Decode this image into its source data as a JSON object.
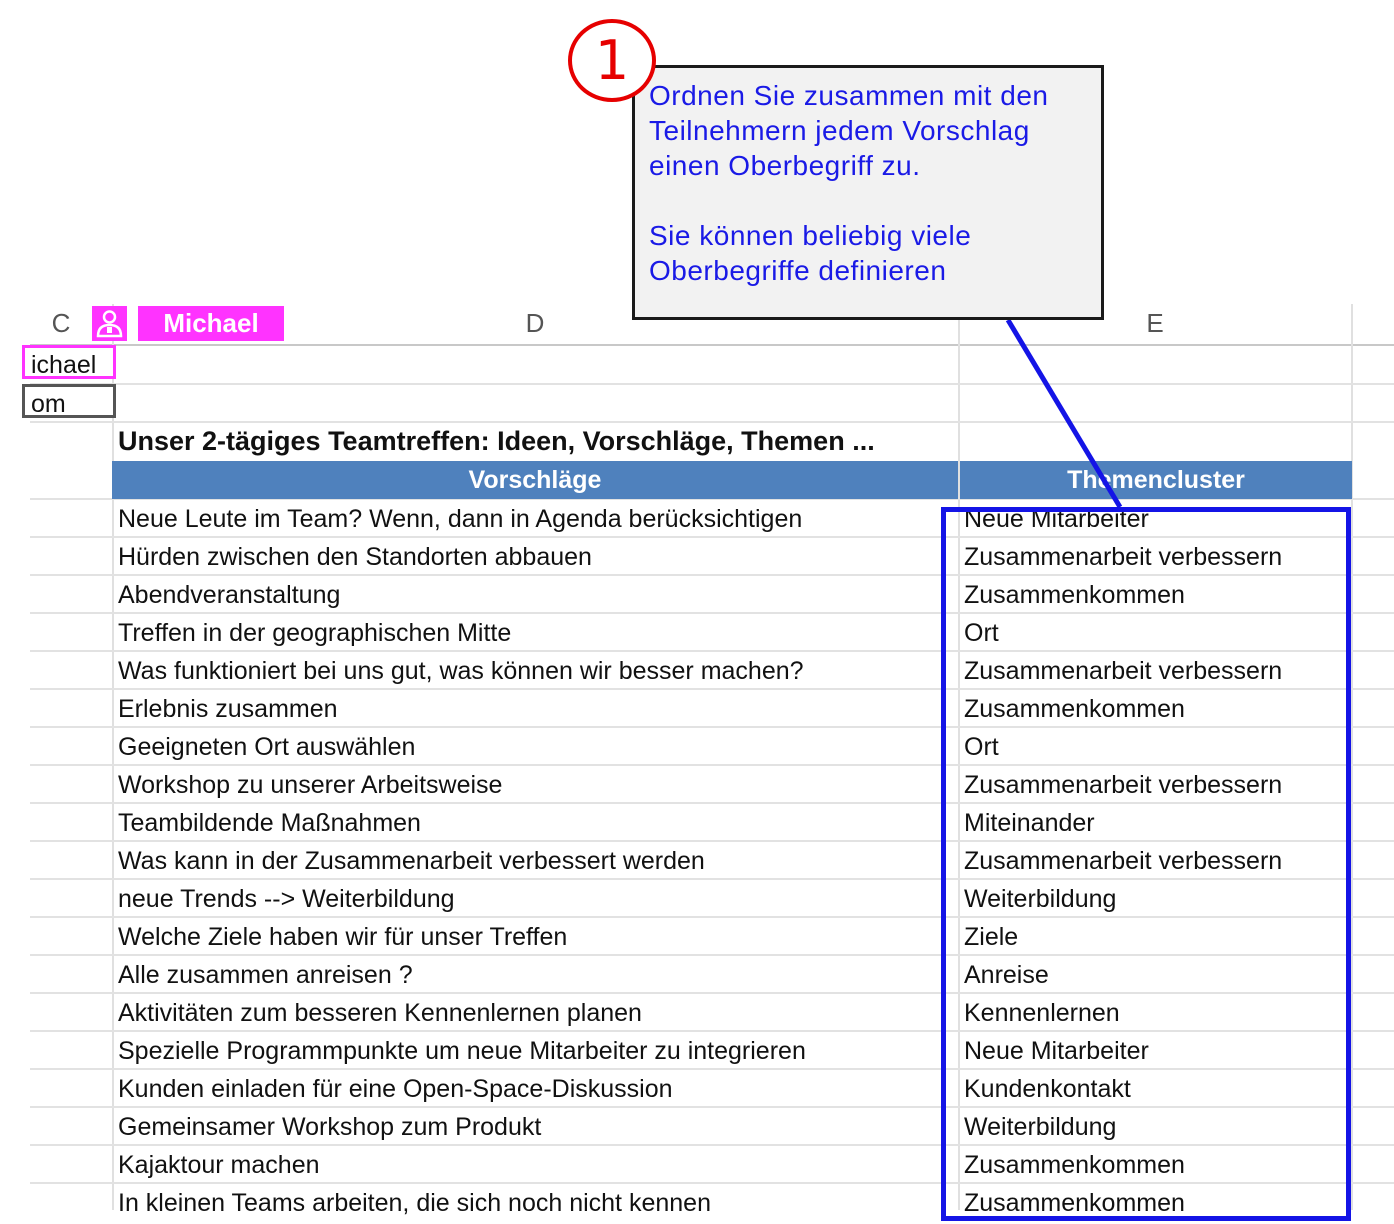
{
  "columns": {
    "c": "C",
    "d": "D",
    "e": "E"
  },
  "collaborator": {
    "name": "Michael",
    "icon": "user-icon",
    "color": "#ff33ff"
  },
  "side_cells": [
    "ichael",
    "om"
  ],
  "sheet_title": "Unser 2-tägiges Teamtreffen: Ideen, Vorschläge, Themen ...",
  "table": {
    "headers": [
      "Vorschläge",
      "Themencluster"
    ],
    "header_color": "#4f81bd",
    "rows": [
      [
        "Neue Leute im Team? Wenn, dann in Agenda berücksichtigen",
        "Neue Mitarbeiter"
      ],
      [
        "Hürden zwischen den Standorten abbauen",
        "Zusammenarbeit verbessern"
      ],
      [
        "Abendveranstaltung",
        "Zusammenkommen"
      ],
      [
        "Treffen in der geographischen Mitte",
        "Ort"
      ],
      [
        "Was funktioniert bei uns gut, was können wir besser machen?",
        "Zusammenarbeit verbessern"
      ],
      [
        "Erlebnis zusammen",
        "Zusammenkommen"
      ],
      [
        "Geeigneten Ort auswählen",
        "Ort"
      ],
      [
        "Workshop zu unserer Arbeitsweise",
        "Zusammenarbeit verbessern"
      ],
      [
        "Teambildende Maßnahmen",
        "Miteinander"
      ],
      [
        "Was kann in der Zusammenarbeit verbessert werden",
        "Zusammenarbeit verbessern"
      ],
      [
        "neue Trends --> Weiterbildung",
        "Weiterbildung"
      ],
      [
        "Welche Ziele haben wir für unser Treffen",
        "Ziele"
      ],
      [
        "Alle zusammen anreisen ?",
        "Anreise"
      ],
      [
        "Aktivitäten zum besseren Kennenlernen planen",
        "Kennenlernen"
      ],
      [
        "Spezielle Programmpunkte um neue Mitarbeiter zu integrieren",
        "Neue Mitarbeiter"
      ],
      [
        "Kunden einladen für eine Open-Space-Diskussion",
        "Kundenkontakt"
      ],
      [
        "Gemeinsamer Workshop zum Produkt",
        "Weiterbildung"
      ],
      [
        "Kajaktour machen",
        "Zusammenkommen"
      ],
      [
        "In kleinen Teams arbeiten, die sich noch nicht kennen",
        "Zusammenkommen"
      ]
    ]
  },
  "callout": {
    "number": "1",
    "paragraph1": "Ordnen Sie zusammen mit den Teilnehmern jedem Vorschlag einen Oberbegriff zu.",
    "paragraph2": "Sie können beliebig viele Oberbegriffe definieren",
    "text_color": "#1a1ae6",
    "badge_color": "#e60000",
    "highlight_color": "#1414e6"
  }
}
